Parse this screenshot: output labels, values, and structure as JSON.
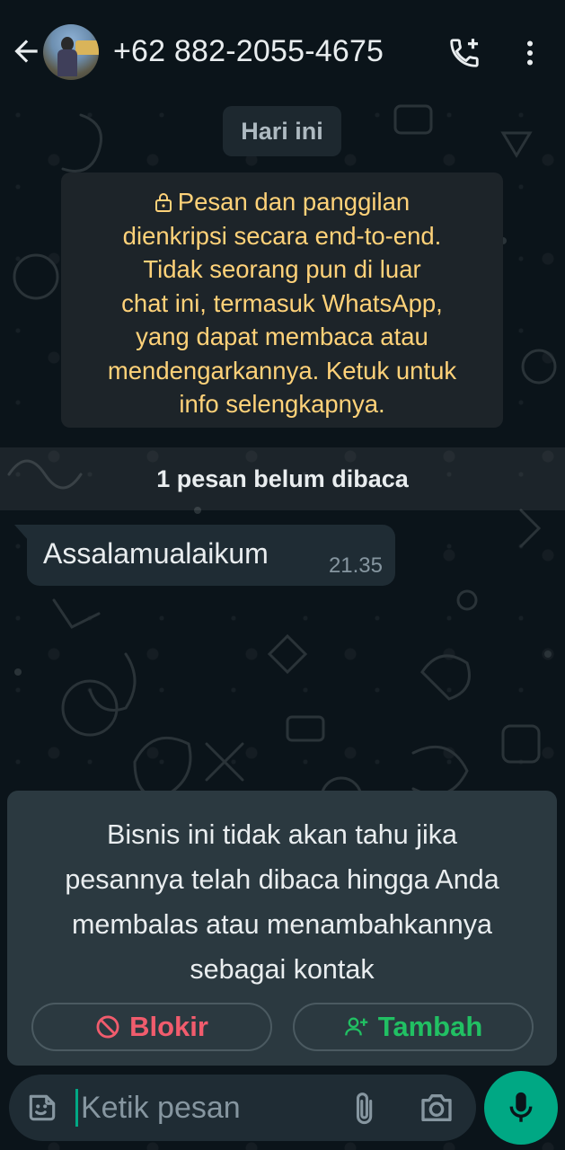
{
  "header": {
    "title": "+62 882-2055-4675",
    "back_icon": "arrow-left-icon",
    "call_icon": "phone-add-icon",
    "menu_icon": "more-vertical-icon"
  },
  "chat": {
    "date_chip": "Hari ini",
    "encryption_lines": [
      "Pesan dan panggilan",
      "dienkripsi secara end-to-end.",
      "Tidak seorang pun di luar",
      "chat ini, termasuk WhatsApp,",
      "yang dapat membaca atau",
      "mendengarkannya. Ketuk untuk",
      "info selengkapnya."
    ],
    "unread_label": "1 pesan belum dibaca",
    "messages": [
      {
        "text": "Assalamualaikum",
        "time": "21.35",
        "direction": "incoming"
      }
    ]
  },
  "business_card": {
    "lines": [
      "Bisnis ini tidak akan tahu jika",
      "pesannya telah dibaca hingga Anda",
      "membalas atau menambahkannya",
      "sebagai kontak"
    ],
    "block_label": "Blokir",
    "add_label": "Tambah"
  },
  "input": {
    "placeholder": "Ketik pesan"
  },
  "colors": {
    "background": "#0b141a",
    "accent": "#00a884",
    "block_red": "#f15c6d",
    "add_green": "#21c063",
    "encryption_yellow": "#ffd279"
  }
}
